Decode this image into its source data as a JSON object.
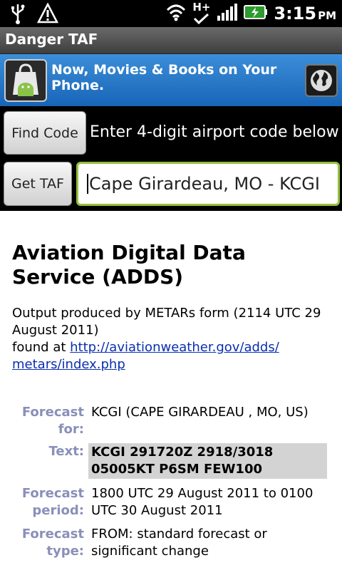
{
  "status": {
    "time": "3:15",
    "ampm": "PM",
    "network": "H+"
  },
  "titlebar": {
    "title": "Danger TAF"
  },
  "ad": {
    "text": "Now, Movies & Books on Your Phone."
  },
  "controls": {
    "find_code_label": "Find Code",
    "hint": "Enter 4-digit airport code below",
    "get_taf_label": "Get TAF",
    "airport_value": "Cape Girardeau, MO  - KCGI"
  },
  "content": {
    "heading": "Aviation Digital Data Service (ADDS)",
    "output_line": "Output produced by METARs form (2114 UTC 29 August 2011)",
    "found_at": "found at",
    "link_text": "http://aviationweather.gov/adds/metars/index.php",
    "rows": [
      {
        "label": "Forecast for:",
        "value": "KCGI (CAPE GIRARDEAU , MO, US)"
      },
      {
        "label": "Text:",
        "value": "KCGI 291720Z 2918/3018 05005KT P6SM FEW100"
      },
      {
        "label": "Forecast period:",
        "value": "1800 UTC 29 August 2011 to 0100 UTC 30 August 2011"
      },
      {
        "label": "Forecast type:",
        "value": "FROM: standard forecast or significant change"
      }
    ]
  }
}
